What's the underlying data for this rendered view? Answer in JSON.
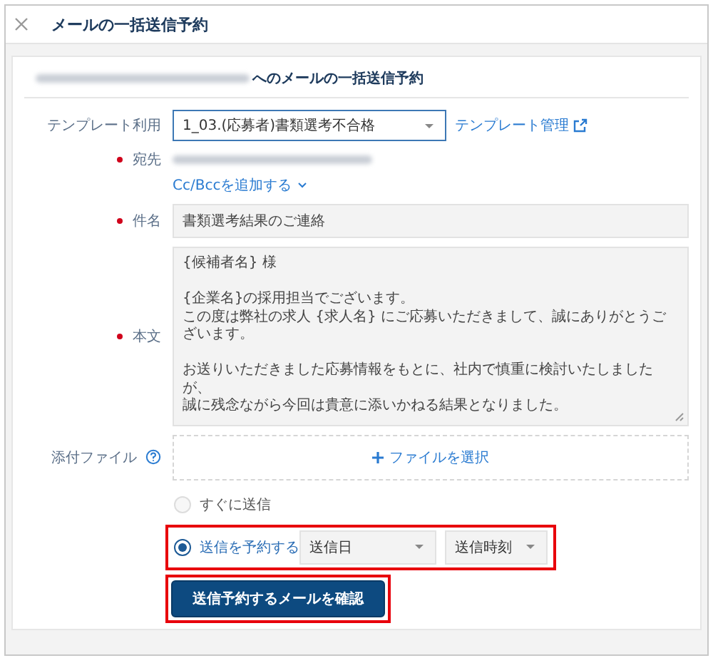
{
  "dialog": {
    "title": "メールの一括送信予約"
  },
  "heading": {
    "text": "へのメールの一括送信予約",
    "redacted_prefix": true
  },
  "template": {
    "label": "テンプレート利用",
    "required": false,
    "value": "1_03.(応募者)書類選考不合格",
    "link": "テンプレート管理"
  },
  "recipient": {
    "label": "宛先",
    "required": true,
    "redacted": true,
    "cc_link": "Cc/Bccを追加する"
  },
  "subject": {
    "label": "件名",
    "required": true,
    "value": "書類選考結果のご連絡"
  },
  "body": {
    "label": "本文",
    "required": true,
    "paragraphs": [
      [
        "{候補者名} 様"
      ],
      [
        "{企業名}の採用担当でございます。",
        "この度は弊社の求人 {求人名} にご応募いただきまして、誠にありがとうございます。"
      ],
      [
        "お送りいただきました応募情報をもとに、社内で慎重に検討いたしましたが、",
        "誠に残念ながら今回は貴意に添いかねる結果となりました。"
      ]
    ]
  },
  "attachment": {
    "label": "添付ファイル",
    "required": false,
    "button": "ファイルを選択"
  },
  "send_options": [
    {
      "label": "すぐに送信",
      "selected": false,
      "highlighted": false
    },
    {
      "label": "送信を予約する",
      "selected": true,
      "highlighted": true,
      "selects": [
        {
          "value": "送信日"
        },
        {
          "value": "送信時刻"
        }
      ]
    }
  ],
  "confirm_button": {
    "label": "送信予約するメールを確認",
    "highlighted": true
  }
}
